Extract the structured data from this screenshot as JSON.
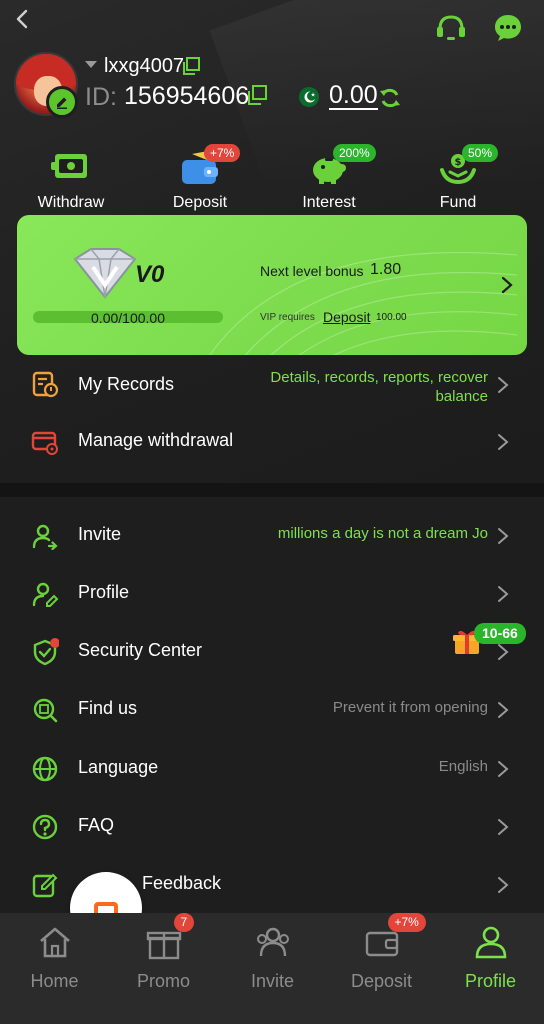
{
  "header": {
    "username": "lxxg4007",
    "id_label": "ID:",
    "id_value": "156954606",
    "balance": "0.00"
  },
  "actions": [
    {
      "label": "Withdraw",
      "badge": ""
    },
    {
      "label": "Deposit",
      "badge": "+7%"
    },
    {
      "label": "Interest",
      "badge": "200%"
    },
    {
      "label": "Fund",
      "badge": "50%"
    }
  ],
  "vip": {
    "level": "V0",
    "progress_text": "0.00/100.00",
    "progress": 0,
    "next_level_label": "Next level bonus",
    "next_level_value": "1.80",
    "requires_label": "VIP requires",
    "requires_link": "Deposit",
    "requires_value": "100.00"
  },
  "menu_top": [
    {
      "label": "My Records",
      "extra_line1": "Details, records, reports, recover",
      "extra_line2": "balance"
    },
    {
      "label": "Manage withdrawal",
      "extra_line1": "",
      "extra_line2": ""
    }
  ],
  "menu_bottom": [
    {
      "label": "Invite",
      "extra": "millions a day is not a dream  Jo"
    },
    {
      "label": "Profile",
      "extra": ""
    },
    {
      "label": "Security Center",
      "extra": ""
    },
    {
      "label": "Find us",
      "extra": "Prevent it from opening"
    },
    {
      "label": "Language",
      "extra": "English"
    },
    {
      "label": "FAQ",
      "extra": ""
    },
    {
      "label": "Feedback",
      "extra": ""
    }
  ],
  "security_gift_badge": "10-66",
  "bottom_nav": [
    {
      "label": "Home",
      "badge": ""
    },
    {
      "label": "Promo",
      "badge": "7"
    },
    {
      "label": "Invite",
      "badge": ""
    },
    {
      "label": "Deposit",
      "badge": "+7%"
    },
    {
      "label": "Profile",
      "badge": ""
    }
  ],
  "colors": {
    "accent": "#7ee04c",
    "card": "#82e052",
    "badge_red": "#e2463a",
    "badge_green": "#2bb52b"
  },
  "icons": {
    "top": [
      "back-icon",
      "headset-icon",
      "chat-icon"
    ],
    "menu": [
      "records-icon",
      "withdrawal-card-icon",
      "invite-user-icon",
      "profile-edit-icon",
      "shield-icon",
      "find-icon",
      "globe-icon",
      "question-icon",
      "feedback-edit-icon"
    ]
  }
}
